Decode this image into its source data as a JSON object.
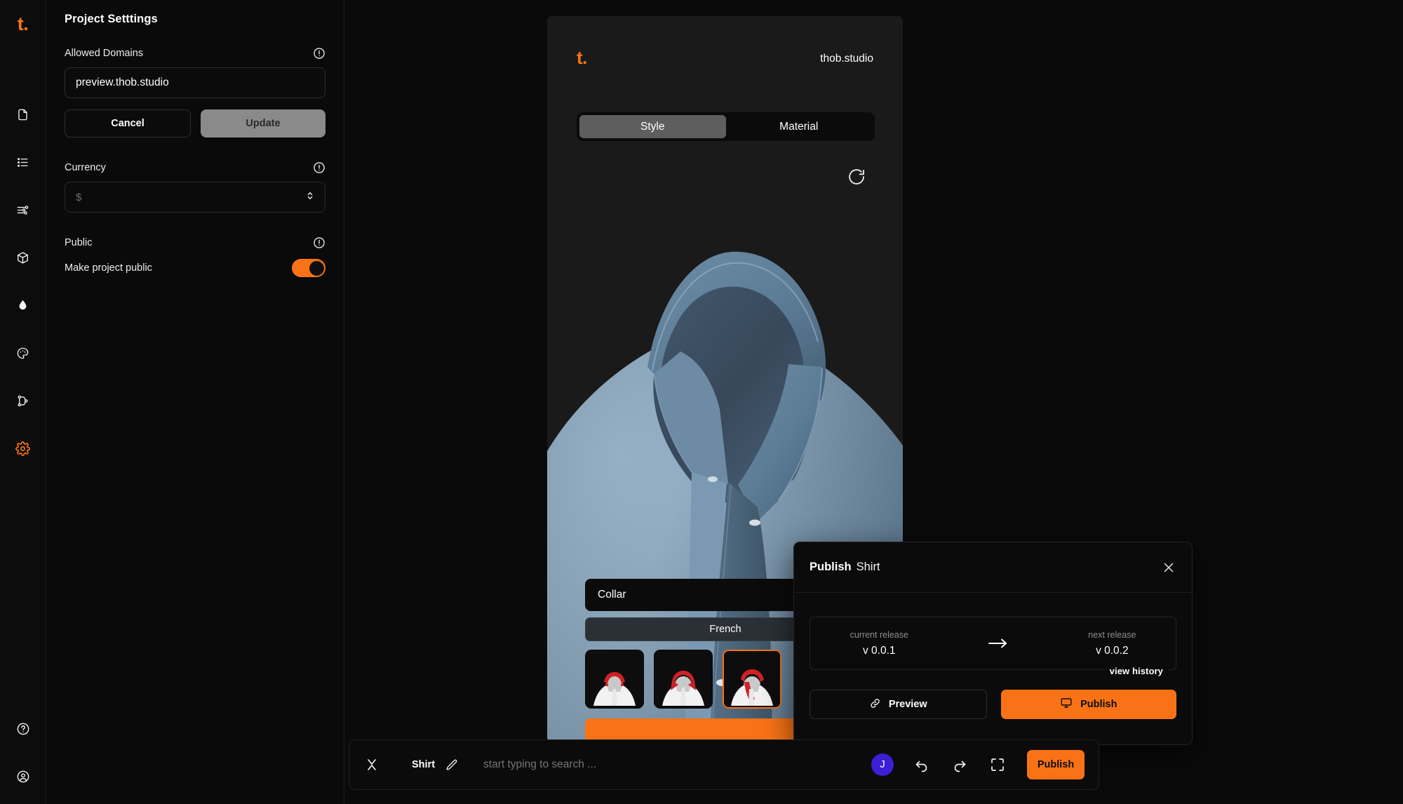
{
  "rail": {
    "logo": "t.",
    "items": [
      {
        "icon": "document-icon",
        "name": "sidebar-item-document"
      },
      {
        "icon": "list-icon",
        "name": "sidebar-item-list"
      },
      {
        "icon": "sliders-icon",
        "name": "sidebar-item-options"
      },
      {
        "icon": "package-icon",
        "name": "sidebar-item-models"
      },
      {
        "icon": "droplet-icon",
        "name": "sidebar-item-colors"
      },
      {
        "icon": "palette-icon",
        "name": "sidebar-item-materials"
      },
      {
        "icon": "branch-icon",
        "name": "sidebar-item-versions"
      },
      {
        "icon": "gear-icon",
        "name": "sidebar-item-settings",
        "active": true
      }
    ],
    "bottom": [
      {
        "icon": "help-circle-icon",
        "name": "sidebar-item-help"
      },
      {
        "icon": "user-circle-icon",
        "name": "sidebar-item-account"
      }
    ]
  },
  "settings": {
    "title": "Project Setttings",
    "allowed_domains": {
      "label": "Allowed Domains",
      "value": "preview.thob.studio",
      "placeholder": "preview.thob.studio",
      "info_icon": "info-icon"
    },
    "cancel_label": "Cancel",
    "update_label": "Update",
    "currency": {
      "label": "Currency",
      "value": "$",
      "info_icon": "info-icon",
      "chevron_icon": "chevron-updown-icon"
    },
    "public": {
      "label": "Public",
      "toggle_label": "Make project public",
      "enabled": true,
      "info_icon": "info-icon"
    }
  },
  "viewer": {
    "logo": "t.",
    "domain": "thob.studio",
    "tabs": [
      {
        "label": "Style",
        "active": true
      },
      {
        "label": "Material",
        "active": false
      }
    ],
    "reset_icon": "refresh-icon",
    "collar": {
      "title": "Collar",
      "selected_option": "French",
      "thumbs": [
        {
          "name": "collar-thumb-band",
          "selected": false
        },
        {
          "name": "collar-thumb-spread",
          "selected": false
        },
        {
          "name": "collar-thumb-french",
          "selected": true
        }
      ]
    }
  },
  "publish_modal": {
    "title": "Publish",
    "subject": "Shirt",
    "close_icon": "close-icon",
    "current_release_label": "current release",
    "current_release_value": "v 0.0.1",
    "arrow_icon": "arrow-right-icon",
    "next_release_label": "next release",
    "next_release_value": "v 0.0.2",
    "view_history_label": "view history",
    "preview_label": "Preview",
    "preview_icon": "link-icon",
    "publish_label": "Publish",
    "publish_icon": "monitor-icon"
  },
  "command_bar": {
    "close_icon": "close-icon",
    "document_name": "Shirt",
    "edit_icon": "pencil-icon",
    "search_placeholder": "start typing to search ...",
    "avatar_initial": "J",
    "undo_icon": "undo-icon",
    "redo_icon": "redo-icon",
    "fullscreen_icon": "fullscreen-icon",
    "publish_label": "Publish"
  },
  "colors": {
    "accent": "#f97316",
    "background": "#0a0a0a",
    "panel": "#0b0b0b",
    "avatar": "#3b1fd4"
  }
}
